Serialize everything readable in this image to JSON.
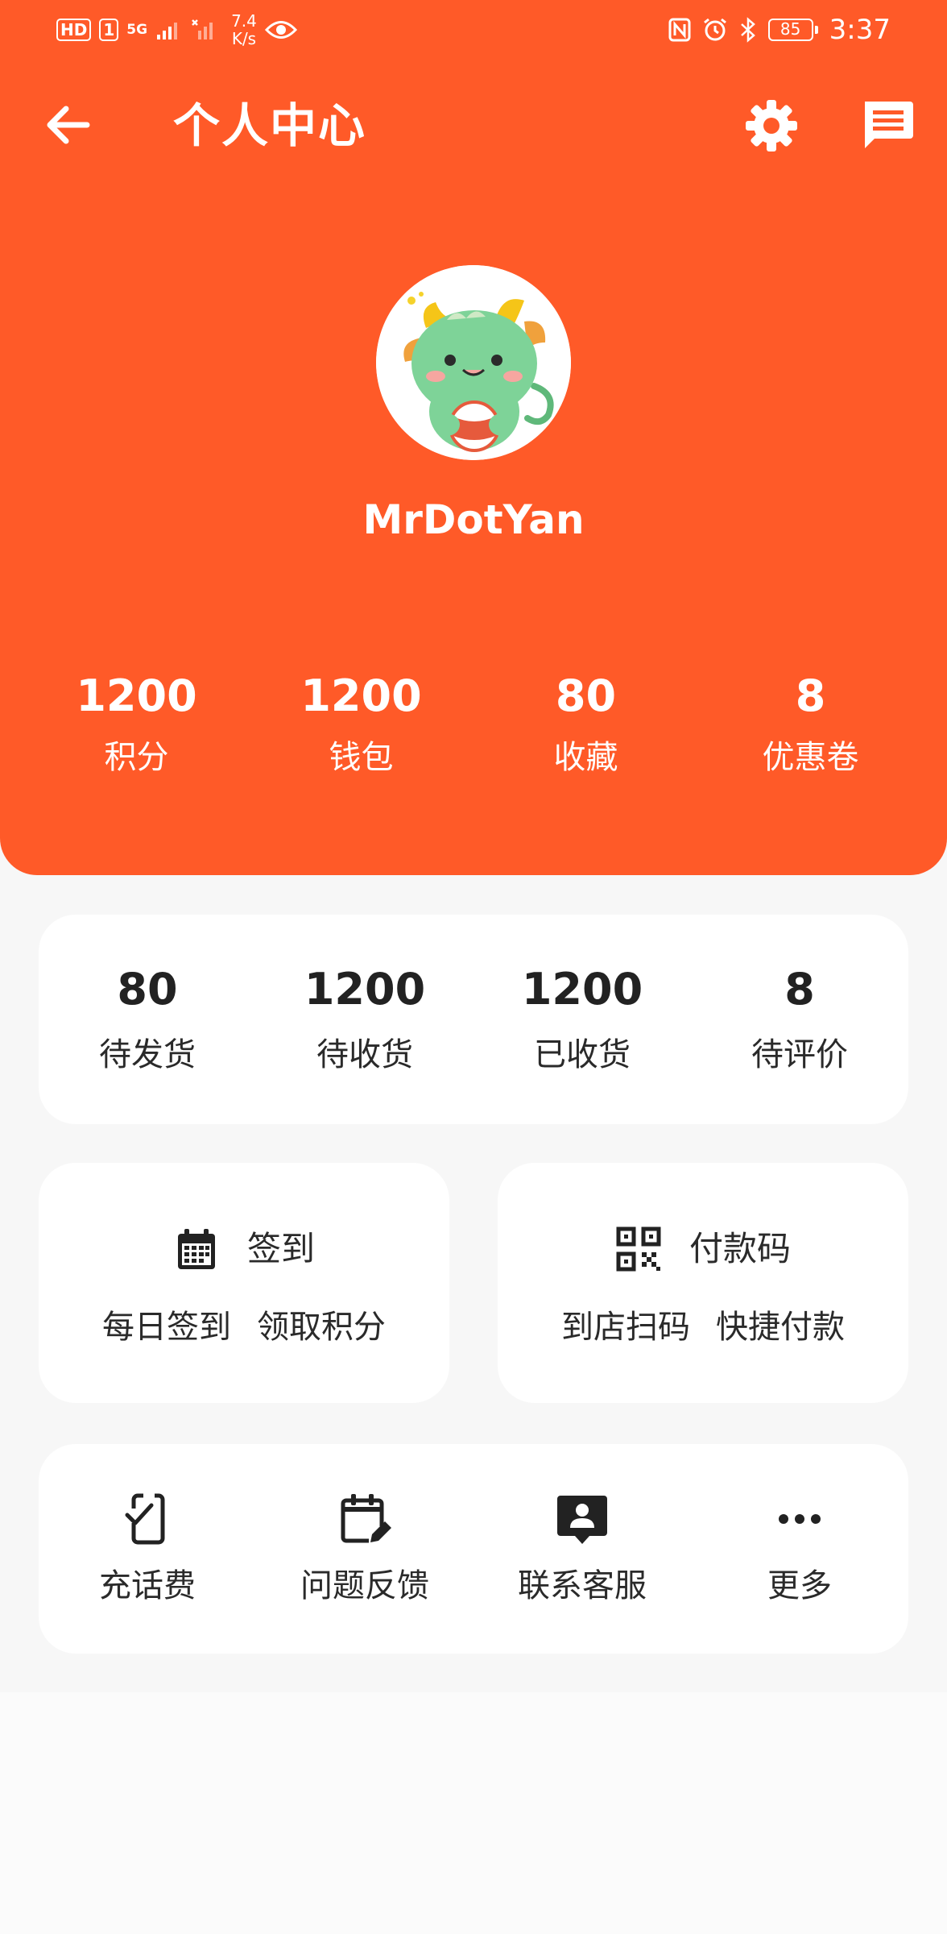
{
  "status_bar": {
    "hd_label": "HD",
    "sim_label": "1",
    "network_label": "5G",
    "speed_value": "7.4",
    "speed_unit": "K/s",
    "battery": "85",
    "time": "3:37"
  },
  "appbar": {
    "title": "个人中心"
  },
  "profile": {
    "username": "MrDotYan"
  },
  "header_stats": [
    {
      "value": "1200",
      "label": "积分"
    },
    {
      "value": "1200",
      "label": "钱包"
    },
    {
      "value": "80",
      "label": "收藏"
    },
    {
      "value": "8",
      "label": "优惠卷"
    }
  ],
  "order_stats": [
    {
      "value": "80",
      "label": "待发货"
    },
    {
      "value": "1200",
      "label": "待收货"
    },
    {
      "value": "1200",
      "label": "已收货"
    },
    {
      "value": "8",
      "label": "待评价"
    }
  ],
  "signin_card": {
    "title": "签到",
    "sub_left": "每日签到",
    "sub_right": "领取积分",
    "icon": "calendar-icon"
  },
  "pay_card": {
    "title": "付款码",
    "sub_left": "到店扫码",
    "sub_right": "快捷付款",
    "icon": "qr-code-icon"
  },
  "tools": [
    {
      "label": "充话费",
      "icon": "phone-check-icon"
    },
    {
      "label": "问题反馈",
      "icon": "feedback-edit-icon"
    },
    {
      "label": "联系客服",
      "icon": "contact-support-icon"
    },
    {
      "label": "更多",
      "icon": "more-dots-icon"
    }
  ],
  "colors": {
    "brand": "#ff5a28",
    "background": "#f7f7f7",
    "card": "#ffffff",
    "text": "#222222"
  }
}
